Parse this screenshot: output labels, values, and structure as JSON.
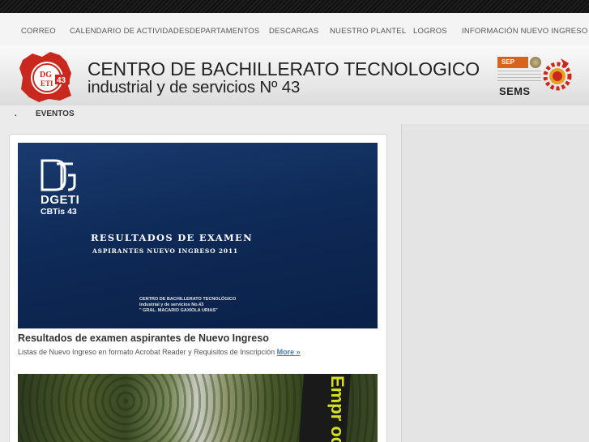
{
  "nav": {
    "items": [
      {
        "label": "CORREO"
      },
      {
        "label": "CALENDARIO DE ACTIVIDADES"
      },
      {
        "label": "DEPARTAMENTOS"
      },
      {
        "label": "DESCARGAS"
      },
      {
        "label": "NUESTRO PLANTEL"
      },
      {
        "label": "LOGROS"
      },
      {
        "label": "INFORMACIÓN NUEVO INGRESO"
      }
    ]
  },
  "header": {
    "title": "CENTRO DE BACHILLERATO TECNOLOGICO",
    "subtitle": "industrial y de servicios Nº 43",
    "left_logo_text": "DGETI 43",
    "sep_label": "SEP",
    "sems_label": "SEMS",
    "icons": [
      "cbtis-43-logo-icon",
      "sep-sems-logo-icon",
      "dgeti-gear-logo-icon"
    ]
  },
  "subnav": {
    "dot": ".",
    "item": "EVENTOS"
  },
  "article": {
    "image": {
      "dgeti": "DGETI",
      "cbtis": "CBTis 43",
      "headline": "RESULTADOS DE EXAMEN",
      "subheadline": "ASPIRANTES NUEVO INGRESO 2011",
      "small_line_1": "CENTRO DE BACHILLERATO TECNOLÓGICO",
      "small_line_2": "industrial y de servicios No.43",
      "small_line_3": "\" GRAL. MACARIO GAXIOLA URIAS\""
    },
    "title": "Resultados de examen aspirantes de Nuevo Ingreso",
    "description": "Listas de Nuevo Ingreso en formato Acrobat Reader y Requisitos de Inscripción ",
    "more_label": "More »"
  },
  "photo": {
    "banner_text": "Empr odo"
  },
  "colors": {
    "topbar": "#151515",
    "nav_bg": "#f4f4f4",
    "image_blue": "#0e2a57",
    "link": "#4a7ab8",
    "sep_orange": "#d6641a",
    "dgeti_red": "#c8281e"
  }
}
